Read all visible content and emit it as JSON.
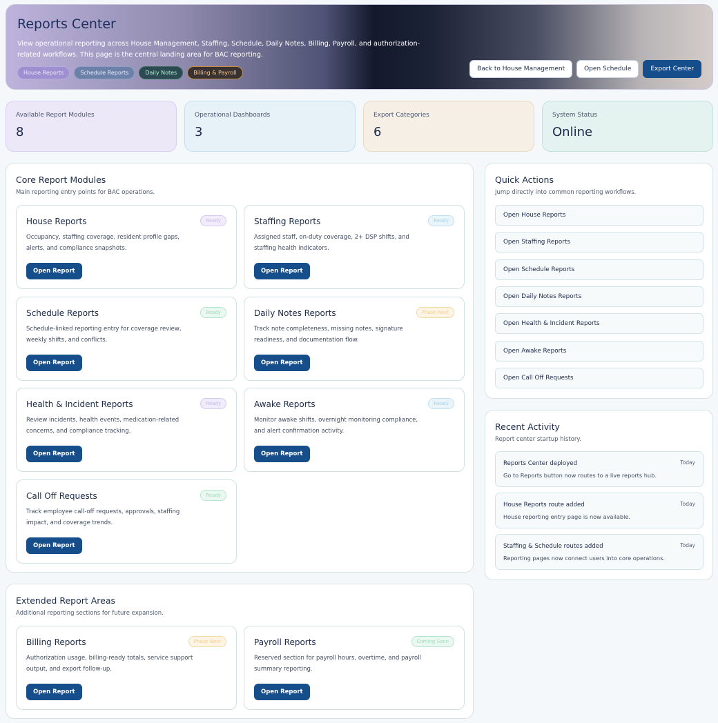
{
  "header": {
    "title": "Reports Center",
    "description": "View operational reporting across House Management, Staffing, Schedule, Daily Notes, Billing, Payroll, and authorization-related workflows. This page is the central landing area for BAC reporting.",
    "chips": [
      "House Reports",
      "Schedule Reports",
      "Daily Notes",
      "Billing & Payroll"
    ],
    "buttons": {
      "back": "Back to House Management",
      "schedule": "Open Schedule",
      "export": "Export Center"
    }
  },
  "stats": [
    {
      "label": "Available Report Modules",
      "value": "8"
    },
    {
      "label": "Operational Dashboards",
      "value": "3"
    },
    {
      "label": "Export Categories",
      "value": "6"
    },
    {
      "label": "System Status",
      "value": "Online"
    }
  ],
  "core": {
    "title": "Core Report Modules",
    "subtitle": "Main reporting entry points for BAC operations.",
    "cards": [
      {
        "title": "House Reports",
        "desc": "Occupancy, staffing coverage, resident profile gaps, alerts, and compliance snapshots.",
        "badge": "Ready",
        "button": "Open Report"
      },
      {
        "title": "Staffing Reports",
        "desc": "Assigned staff, on-duty coverage, 2+ DSP shifts, and staffing health indicators.",
        "badge": "Ready",
        "button": "Open Report"
      },
      {
        "title": "Schedule Reports",
        "desc": "Schedule-linked reporting entry for coverage review, weekly shifts, and conflicts.",
        "badge": "Ready",
        "button": "Open Report"
      },
      {
        "title": "Daily Notes Reports",
        "desc": "Track note completeness, missing notes, signature readiness, and documentation flow.",
        "badge": "Phase Next",
        "button": "Open Report"
      },
      {
        "title": "Health & Incident Reports",
        "desc": "Review incidents, health events, medication-related concerns, and compliance tracking.",
        "badge": "Ready",
        "button": "Open Report"
      },
      {
        "title": "Awake Reports",
        "desc": "Monitor awake shifts, overnight monitoring compliance, and alert confirmation activity.",
        "badge": "Ready",
        "button": "Open Report"
      },
      {
        "title": "Call Off Requests",
        "desc": "Track employee call-off requests, approvals, staffing impact, and coverage trends.",
        "badge": "Ready",
        "button": "Open Report"
      }
    ]
  },
  "extended": {
    "title": "Extended Report Areas",
    "subtitle": "Additional reporting sections for future expansion.",
    "cards": [
      {
        "title": "Billing Reports",
        "desc": "Authorization usage, billing-ready totals, service support output, and export follow-up.",
        "badge": "Phase Next",
        "button": "Open Report"
      },
      {
        "title": "Payroll Reports",
        "desc": "Reserved section for payroll hours, overtime, and payroll summary reporting.",
        "badge": "Coming Soon",
        "button": "Open Report"
      }
    ]
  },
  "quick_actions": {
    "title": "Quick Actions",
    "subtitle": "Jump directly into common reporting workflows.",
    "items": [
      "Open House Reports",
      "Open Staffing Reports",
      "Open Schedule Reports",
      "Open Daily Notes Reports",
      "Open Health & Incident Reports",
      "Open Awake Reports",
      "Open Call Off Requests"
    ]
  },
  "recent_activity": {
    "title": "Recent Activity",
    "subtitle": "Report center startup history.",
    "items": [
      {
        "title": "Reports Center deployed",
        "desc": "Go to Reports button now routes to a live reports hub.",
        "time": "Today"
      },
      {
        "title": "House Reports route added",
        "desc": "House reporting entry page is now available.",
        "time": "Today"
      },
      {
        "title": "Staffing & Schedule routes added",
        "desc": "Reporting pages now connect users into core operations.",
        "time": "Today"
      }
    ]
  }
}
